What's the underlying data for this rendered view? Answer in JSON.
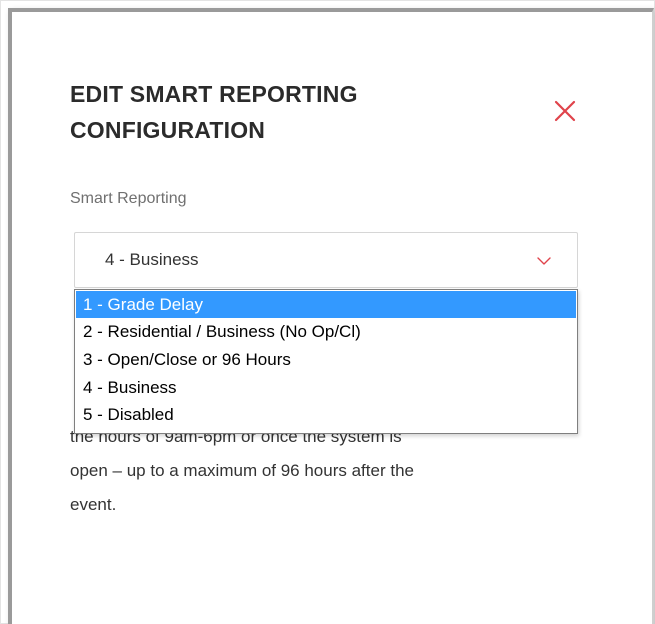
{
  "dialog": {
    "title_line1": "EDIT SMART REPORTING",
    "title_line2": "CONFIGURATION",
    "close_icon": "close-x-icon",
    "close_color": "#e0434b"
  },
  "field": {
    "label": "Smart Reporting",
    "selected_value": "4 - Business",
    "chevron_icon": "chevron-down-icon"
  },
  "dropdown": {
    "options": [
      {
        "label": "1 - Grade Delay",
        "highlighted": true
      },
      {
        "label": "2 - Residential / Business (No Op/Cl)",
        "highlighted": false
      },
      {
        "label": "3 - Open/Close or 96 Hours",
        "highlighted": false
      },
      {
        "label": "4 - Business",
        "highlighted": false
      },
      {
        "label": "5 - Disabled",
        "highlighted": false
      }
    ],
    "highlight_color": "#3399ff"
  },
  "description": {
    "line1": "the hours of 9am-6pm or once the system is",
    "line2": "open – up to a maximum of 96 hours after the",
    "line3": "event."
  }
}
